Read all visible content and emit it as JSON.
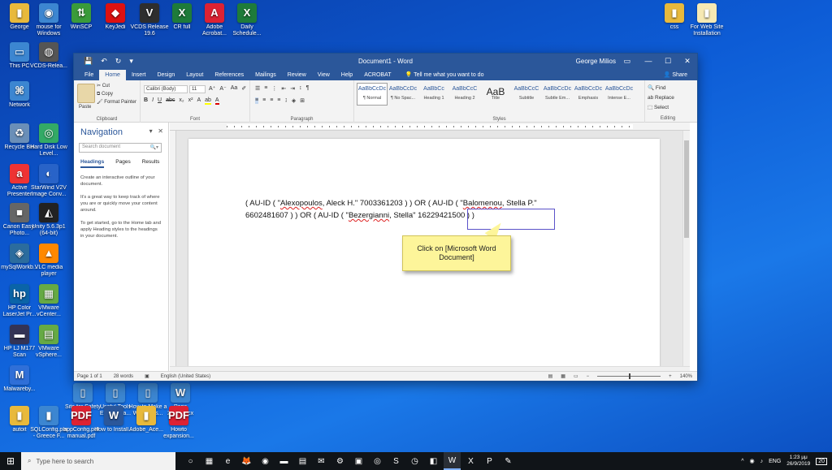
{
  "desktop_icons": [
    {
      "id": "george",
      "label": "George",
      "color": "#e8b93c",
      "glyph": "▮"
    },
    {
      "id": "mouse",
      "label": "mouse for Windows",
      "color": "#3c86d1",
      "glyph": "◉"
    },
    {
      "id": "winscp",
      "label": "WinSCP",
      "color": "#3a9b3a",
      "glyph": "⇅"
    },
    {
      "id": "keyjedi",
      "label": "KeyJedi",
      "color": "#d11",
      "glyph": "◆"
    },
    {
      "id": "vcds",
      "label": "VCDS Release 19.6",
      "color": "#2e2e2e",
      "glyph": "V"
    },
    {
      "id": "cr-full",
      "label": "CR full",
      "color": "#1e7b3a",
      "glyph": "X"
    },
    {
      "id": "adobe-acrobat",
      "label": "Adobe Acrobat...",
      "color": "#d23",
      "glyph": "A"
    },
    {
      "id": "daily-schedule",
      "label": "Daily Schedule...",
      "color": "#1e7b3a",
      "glyph": "X"
    },
    {
      "id": "thispc",
      "label": "This PC",
      "color": "#3c86d1",
      "glyph": "▭"
    },
    {
      "id": "vcds-2",
      "label": "VCDS-Relea...",
      "color": "#555",
      "glyph": "◍"
    },
    {
      "id": "network",
      "label": "Network",
      "color": "#3c86d1",
      "glyph": "⌘"
    },
    {
      "id": "recycle",
      "label": "Recycle Bin",
      "color": "#6a8fb8",
      "glyph": "♻"
    },
    {
      "id": "harddisk",
      "label": "Hard Disk Low Level...",
      "color": "#3a6",
      "glyph": "◎"
    },
    {
      "id": "active-presenter",
      "label": "Active Presenter",
      "color": "#e33",
      "glyph": "a"
    },
    {
      "id": "starwind",
      "label": "StarWind V2V Image Conv...",
      "color": "#2863c8",
      "glyph": "◐"
    },
    {
      "id": "canon",
      "label": "Canon Easy-Photo...",
      "color": "#666",
      "glyph": "■"
    },
    {
      "id": "unity",
      "label": "Unity 5.6.3p1 (64-bit)",
      "color": "#222",
      "glyph": "◭"
    },
    {
      "id": "mysqlworkbench",
      "label": "mySqlWorkb...",
      "color": "#2b6c9e",
      "glyph": "◈"
    },
    {
      "id": "vlc",
      "label": "VLC media player",
      "color": "#f80",
      "glyph": "▲"
    },
    {
      "id": "hp-color",
      "label": "HP Color LaserJet Pr...",
      "color": "#0a64a8",
      "glyph": "hp"
    },
    {
      "id": "vmware-vcenter",
      "label": "VMware vCenter...",
      "color": "#6a4",
      "glyph": "▦"
    },
    {
      "id": "hp-scan",
      "label": "HP LJ M177 Scan",
      "color": "#335",
      "glyph": "▬"
    },
    {
      "id": "vmware-vsphere",
      "label": "VMware vSphere...",
      "color": "#6a4",
      "glyph": "▤"
    },
    {
      "id": "malwarebytes",
      "label": "Malwareby...",
      "color": "#2f6fd8",
      "glyph": "M"
    },
    {
      "id": "site-safety",
      "label": "Site for Safety",
      "color": "#3c86d1",
      "glyph": "▯"
    },
    {
      "id": "useful-tools",
      "label": "Useful Tools Encryp Pa...",
      "color": "#3c86d1",
      "glyph": "▯"
    },
    {
      "id": "how-to-make",
      "label": "How to Make a WordPres...",
      "color": "#3c86d1",
      "glyph": "▯"
    },
    {
      "id": "paris",
      "label": "Paris 2018.docx",
      "color": "#3c86d1",
      "glyph": "W"
    },
    {
      "id": "autoit",
      "label": "autoit",
      "color": "#e8b93c",
      "glyph": "▮"
    },
    {
      "id": "sqlconfig",
      "label": "SQLConfig.pbi - Greece F...",
      "color": "#3c86d1",
      "glyph": "▮"
    },
    {
      "id": "appconfig",
      "label": "appConfig.pdf manual.pdf",
      "color": "#d23",
      "glyph": "PDF"
    },
    {
      "id": "how-to-install",
      "label": "How to Install...",
      "color": "#2b579a",
      "glyph": "W"
    },
    {
      "id": "adobe-ace",
      "label": "Adobe_Ace...",
      "color": "#e8b93c",
      "glyph": "▮"
    },
    {
      "id": "howto-expan",
      "label": "Howto expansion...",
      "color": "#d23",
      "glyph": "PDF"
    },
    {
      "id": "css",
      "label": "css",
      "color": "#e8b93c",
      "glyph": "▮"
    },
    {
      "id": "for-web-site",
      "label": "For Web Site Installation",
      "color": "#f6e9b3",
      "glyph": "▮"
    }
  ],
  "word": {
    "title": "Document1 - Word",
    "user": "George Milios",
    "tabs": [
      "File",
      "Home",
      "Insert",
      "Design",
      "Layout",
      "References",
      "Mailings",
      "Review",
      "View",
      "Help",
      "ACROBAT"
    ],
    "active_tab": "Home",
    "tell_me": "Tell me what you want to do",
    "share": "Share",
    "clipboard": {
      "paste": "Paste",
      "cut": "Cut",
      "copy": "Copy",
      "format_painter": "Format Painter",
      "label": "Clipboard"
    },
    "font": {
      "name": "Calibri (Body)",
      "size": "11",
      "label": "Font"
    },
    "paragraph_label": "Paragraph",
    "styles_label": "Styles",
    "styles": [
      {
        "preview": "AaBbCcDc",
        "name": "¶ Normal",
        "selected": true
      },
      {
        "preview": "AaBbCcDc",
        "name": "¶ No Spac...",
        "selected": false
      },
      {
        "preview": "AaBbCc",
        "name": "Heading 1",
        "selected": false
      },
      {
        "preview": "AaBbCcC",
        "name": "Heading 2",
        "selected": false
      },
      {
        "preview": "AaB",
        "name": "Title",
        "selected": false
      },
      {
        "preview": "AaBbCcC",
        "name": "Subtitle",
        "selected": false
      },
      {
        "preview": "AaBbCcDc",
        "name": "Subtle Em...",
        "selected": false
      },
      {
        "preview": "AaBbCcDc",
        "name": "Emphasis",
        "selected": false
      },
      {
        "preview": "AaBbCcDc",
        "name": "Intense E...",
        "selected": false
      }
    ],
    "editing": {
      "find": "Find",
      "replace": "Replace",
      "select": "Select",
      "label": "Editing"
    },
    "navigation": {
      "title": "Navigation",
      "search_placeholder": "Search document",
      "tabs": [
        "Headings",
        "Pages",
        "Results"
      ],
      "p1": "Create an interactive outline of your document.",
      "p2": "It's a great way to keep track of where you are or quickly move your content around.",
      "p3": "To get started, go to the Home tab and apply Heading styles to the headings in your document."
    },
    "document_text": {
      "part1": "( AU-ID ( \"",
      "name1": "Alexopoulos",
      "part2": ", Aleck H.\"   7003361203 ) )  OR  ( AU-ID ( \"",
      "name2": "Balomenou",
      "part3": ", Stella P.\"   6602481607 ) )  OR  ( AU-ID ( \"",
      "name3": "Bezergianni",
      "part4": ", Stella\"   16229421500 ) )"
    },
    "status": {
      "page": "Page 1 of 1",
      "words": "28 words",
      "language": "English (United States)",
      "zoom": "140%"
    }
  },
  "callout": "Click on [Microsoft Word Document]",
  "taskbar": {
    "search_placeholder": "Type here to search",
    "apps": [
      "○",
      "▦",
      "e",
      "🦊",
      "◉",
      "▬",
      "▤",
      "✉",
      "⚙",
      "▣",
      "◎",
      "S",
      "◷",
      "◧",
      "W",
      "X",
      "P",
      "✎"
    ],
    "active_app_index": 14,
    "language": "ENG",
    "time": "1:23 μμ",
    "date": "26/9/2019",
    "notifications": "20"
  }
}
